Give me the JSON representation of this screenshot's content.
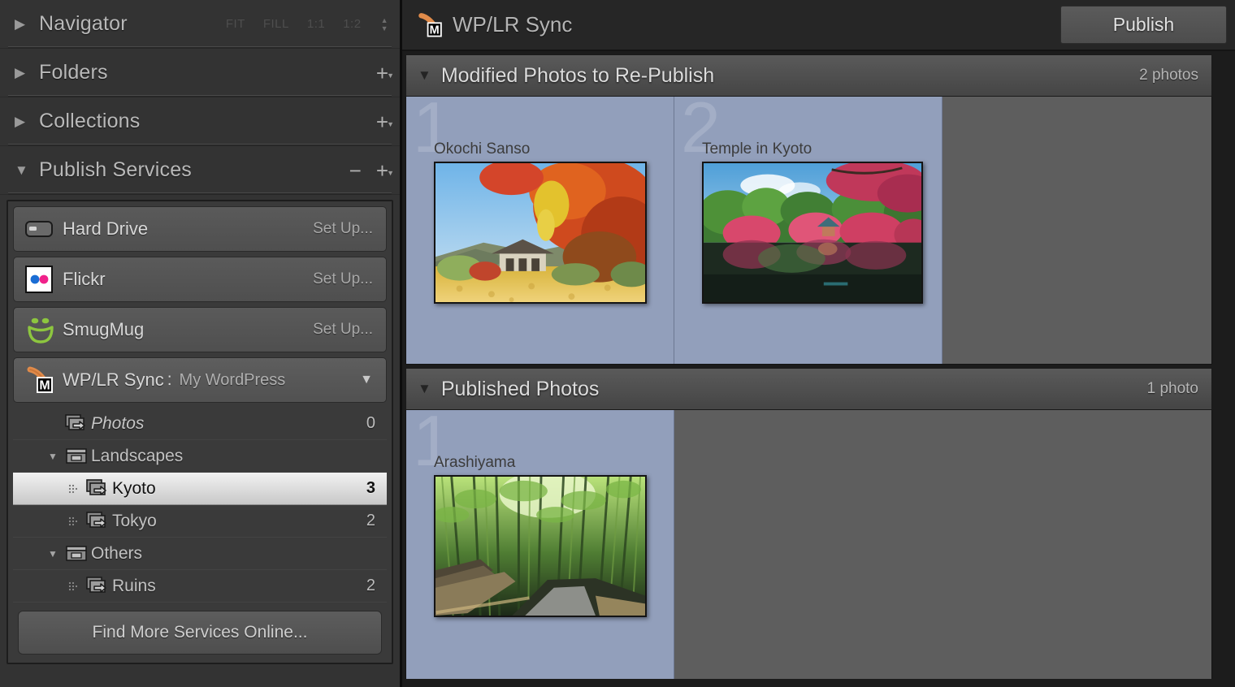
{
  "sidebar": {
    "panels": [
      {
        "name": "navigator",
        "title": "Navigator",
        "twisty": "▶",
        "zoom_levels": [
          "FIT",
          "FILL",
          "1:1",
          "1:2"
        ]
      },
      {
        "name": "folders",
        "title": "Folders",
        "twisty": "▶"
      },
      {
        "name": "collections",
        "title": "Collections",
        "twisty": "▶"
      },
      {
        "name": "publish-services",
        "title": "Publish Services",
        "twisty": "▼"
      }
    ],
    "services": [
      {
        "name": "Hard Drive",
        "icon": "hard-drive-icon",
        "action": "Set Up...",
        "selected": false
      },
      {
        "name": "Flickr",
        "icon": "flickr-icon",
        "action": "Set Up...",
        "selected": false
      },
      {
        "name": "SmugMug",
        "icon": "smugmug-icon",
        "action": "Set Up...",
        "selected": false
      },
      {
        "name": "WP/LR Sync",
        "icon": "wplr-icon",
        "account": "My WordPress",
        "separator": ":",
        "selected": true
      }
    ],
    "tree": [
      {
        "label": "Photos",
        "count": "0",
        "icon": "collection-icon",
        "indent": 1,
        "italic": true,
        "selected": false,
        "twisty": ""
      },
      {
        "label": "Landscapes",
        "count": "",
        "icon": "collection-set-icon",
        "indent": 2,
        "italic": false,
        "selected": false,
        "twisty": "▼"
      },
      {
        "label": "Kyoto",
        "count": "3",
        "icon": "collection-icon",
        "indent": 3,
        "italic": false,
        "selected": true,
        "twisty": ""
      },
      {
        "label": "Tokyo",
        "count": "2",
        "icon": "collection-icon",
        "indent": 3,
        "italic": false,
        "selected": false,
        "twisty": ""
      },
      {
        "label": "Others",
        "count": "",
        "icon": "collection-set-icon",
        "indent": 2,
        "italic": false,
        "selected": false,
        "twisty": "▼"
      },
      {
        "label": "Ruins",
        "count": "2",
        "icon": "collection-icon",
        "indent": 3,
        "italic": false,
        "selected": false,
        "twisty": ""
      }
    ],
    "find_more_button": "Find More Services Online..."
  },
  "topbar": {
    "title": "WP/LR Sync",
    "icon": "wplr-icon",
    "publish_button": "Publish"
  },
  "sections": [
    {
      "name": "modified-photos",
      "title": "Modified Photos to Re-Publish",
      "count": "2 photos",
      "twisty": "▼",
      "photos": [
        {
          "index": "1",
          "caption": "Okochi Sanso",
          "thumb": "autumn-temple-thumb"
        },
        {
          "index": "2",
          "caption": "Temple in Kyoto",
          "thumb": "kyoto-pond-thumb"
        }
      ]
    },
    {
      "name": "published-photos",
      "title": "Published Photos",
      "count": "1 photo",
      "twisty": "▼",
      "photos": [
        {
          "index": "1",
          "caption": "Arashiyama",
          "thumb": "bamboo-grove-thumb"
        }
      ]
    }
  ],
  "colors": {
    "panel_bg": "#333333",
    "grid_bg": "#5e5e5e",
    "cell_selected": "#929fbb",
    "selection_highlight": "#e6e6e6",
    "flickr_blue": "#1a6dd4",
    "flickr_pink": "#f0218a",
    "smugmug_green": "#8dc63f",
    "wplr_orange": "#e08b4a"
  }
}
